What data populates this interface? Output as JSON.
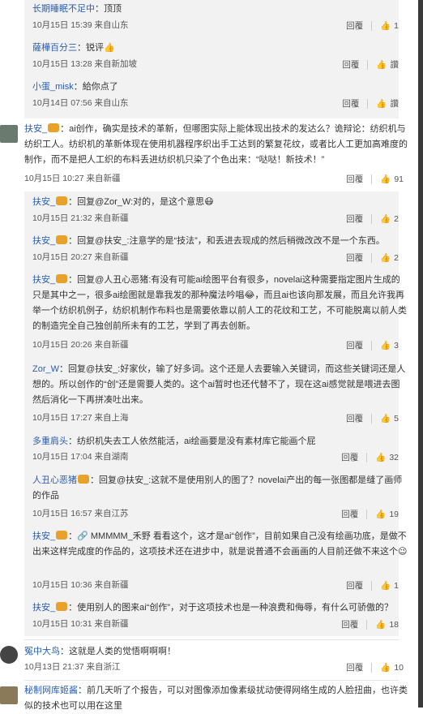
{
  "comments": [
    {
      "user": "长期睡眠不足中",
      "text": "：顶顶",
      "meta": "10月15日 15:39 来自山东",
      "reply": "回覆",
      "likes": "1"
    },
    {
      "user": "薩樺百分三",
      "text": "：锐评👍",
      "meta": "10月15日 13:28 来自新加坡",
      "reply": "回覆",
      "likes": "讚"
    },
    {
      "user": "小蛋_misk",
      "text": "：給你点了",
      "meta": "10月14日 07:56 来自山东",
      "reply": "回覆",
      "likes": "讚"
    },
    {
      "user": "扶安_",
      "text": "：ai创作，确实是技术的革新，但哪图实际上能体现出技术的发达么？诡辩论：纺织机与纺织工人。纺织机的革新体现在使用机器程序织出手工达到的繁复花纹，或者比人工更加高难度的制作，而不是把人工织的布料丢进纺织机只染了个色出来：“哒哒！新技术！”",
      "meta": "10月15日 10:27 来自新疆",
      "reply": "回覆",
      "likes": "91"
    },
    {
      "user": "扶安_",
      "text": "：回复@Zor_W:对的，是这个意思😷",
      "meta": "10月15日 21:32 来自新疆",
      "reply": "回覆",
      "likes": "2"
    },
    {
      "user": "扶安_",
      "text": "：回复@扶安_:注意学的是“技法”，和丢进去现成的然后稍微改改不是一个东西。",
      "meta": "10月15日 20:27 来自新疆",
      "reply": "回覆",
      "likes": "2"
    },
    {
      "user": "扶安_",
      "text": "：回复@人丑心恶猪:有没有可能ai绘图平台有很多，novelai这种需要指定图片生成的只是其中之一，很多ai绘图就是靠我发的那种魔法吟唱😂，而且ai也该向那发展，而且允许我再举一个纺织机例子，纺织机制作布料也是需要依靠以前人工的花纹和工艺，不可能脱离以前人类的制造完全自己独创前所未有的工艺，学到了再去创新。",
      "meta": "10月15日 20:26 来自新疆",
      "reply": "回覆",
      "likes": "3"
    },
    {
      "user": "Zor_W",
      "text": "：回复@扶安_:好家伙，输了好多词。这个还是人去要输入关键词，而这些关键词还是人想的。所以创作的“创”还是需要人类的。这个ai暂时也还代替不了，现在这ai感觉就是喂进去图然后消化一下再拼凑吐出来。",
      "meta": "10月15日 17:27 来自上海",
      "reply": "回覆",
      "likes": "5"
    },
    {
      "user": "多重肩头",
      "text": "：纺织机失去工人依然能活，ai绘画要是没有素材库它能画个屁",
      "meta": "10月15日 17:04 来自湖南",
      "reply": "回覆",
      "likes": "32"
    },
    {
      "user": "人丑心恶猪",
      "text": "：回复@扶安_:这就不是使用别人的图了？novelai产出的每一张图都是缝了画师的作品",
      "meta": "10月15日 16:57 来自江苏",
      "reply": "回覆",
      "likes": "19"
    },
    {
      "user": "扶安_",
      "text": "：🔗 MMMMM_禾野 看看这个，这才是ai“创作”，目前如果自己没有绘画功底，是做不出来这样完成度的作品的，这项技术还在进步中，就是说普通不会画画的人目前还做不来这个😉",
      "meta": "10月15日 10:36 来自新疆",
      "reply": "回覆",
      "likes": "1"
    },
    {
      "user": "扶安_",
      "text": "：使用别人的图来ai“创作”，对于这项技术也是一种浪费和侮辱，有什么可骄傲的？",
      "meta": "10月15日 10:31 来自新疆",
      "reply": "回覆",
      "likes": "18"
    },
    {
      "user": "冤中大鸟",
      "text": "：这就是人类的觉悟啊啊啊！",
      "meta": "10月13日 21:37 来自浙江",
      "reply": "回覆",
      "likes": "10"
    },
    {
      "user": "秘制网库姬酱",
      "text": "：前几天听了个报告，可以对图像添加像素级扰动使得网络生成的人脸扭曲，也许类似的技术也可以用在这里",
      "meta": "",
      "reply": "",
      "likes": ""
    }
  ]
}
